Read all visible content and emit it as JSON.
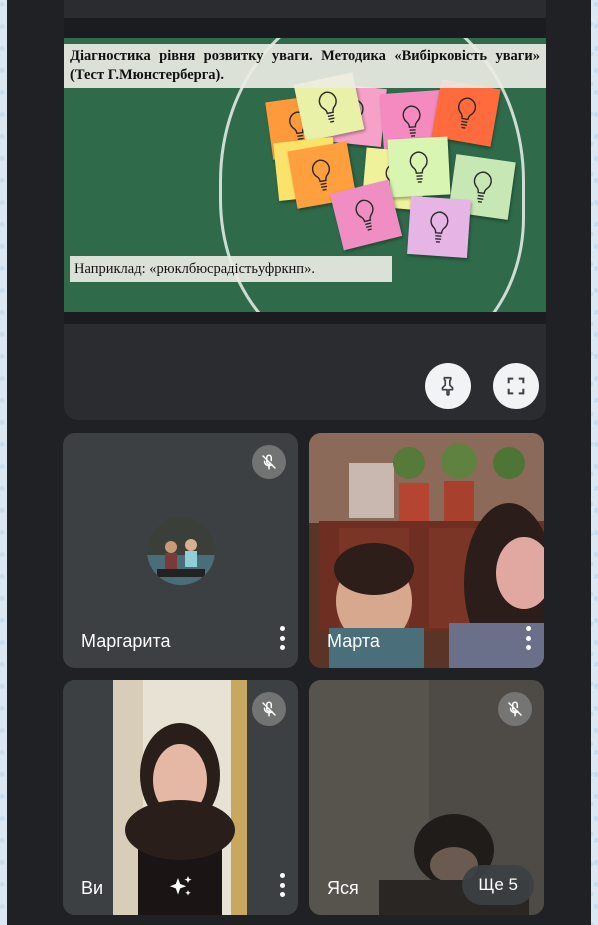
{
  "presentation": {
    "title": "Діагностика рівня розвитку уваги. Методика «Вибірковість уваги» (Тест Г.Мюнстерберга).",
    "example": "Наприклад: «рюклбюсрадістьуфркнп»."
  },
  "participants": [
    {
      "name": "Маргарита",
      "muted": true,
      "has_avatar": true
    },
    {
      "name": "Марта",
      "muted": false
    },
    {
      "name": "Ви",
      "muted": true
    },
    {
      "name": "Яся",
      "muted": true
    }
  ],
  "more_participants_label": "Ще 5",
  "icons": {
    "pin": "pin-icon",
    "fullscreen": "fullscreen-icon",
    "mic_off": "mic-off-icon",
    "more": "more-vert-icon",
    "effects": "sparkle-effects-icon"
  },
  "colors": {
    "background": "#202124",
    "tile": "#3c4043",
    "chalkboard": "#2f6b4b"
  }
}
